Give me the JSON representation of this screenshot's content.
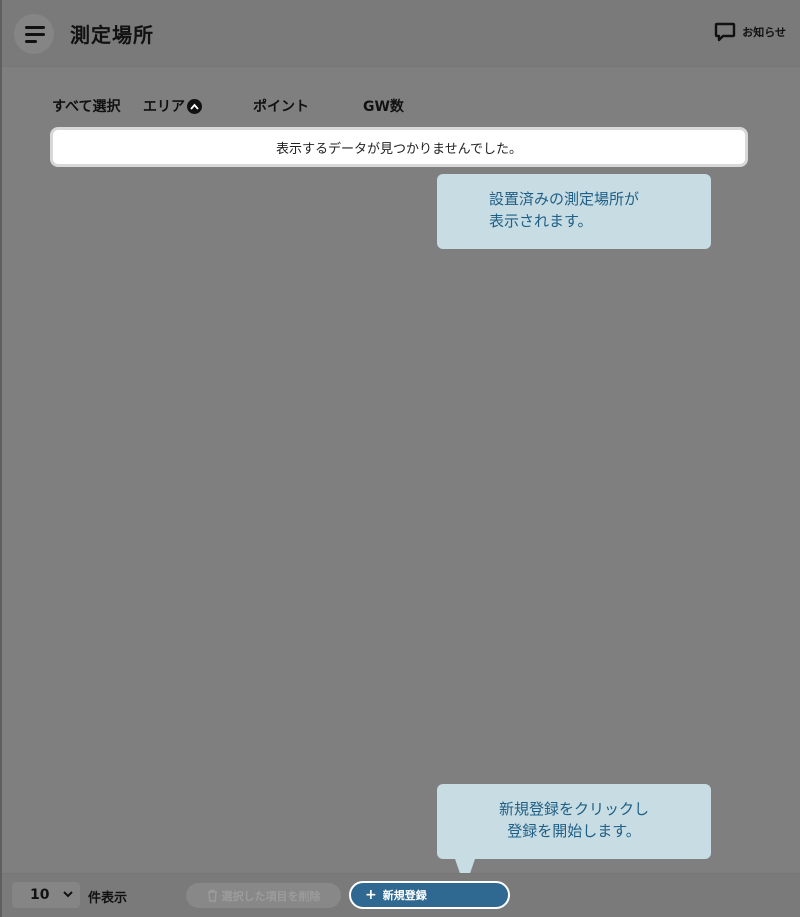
{
  "header": {
    "title": "測定場所",
    "notice_label": "お知らせ"
  },
  "table": {
    "columns": [
      {
        "label": "すべて選択"
      },
      {
        "label": "エリア"
      },
      {
        "label": "ポイント"
      },
      {
        "label": "GW数"
      }
    ],
    "empty_message": "表示するデータが見つかりませんでした。"
  },
  "tooltips": {
    "list_hint_line1": "設置済みの測定場所が",
    "list_hint_line2": "表示されます。",
    "new_hint_line1": "新規登録をクリックし",
    "new_hint_line2": "登録を開始します。"
  },
  "footer": {
    "page_size_value": "10",
    "page_size_label": "件表示",
    "delete_label": "選択した項目を削除",
    "new_label": "新規登録"
  },
  "colors": {
    "accent": "#2f6891",
    "tooltip_bg": "#c7dce3",
    "tooltip_text": "#1f5f86",
    "overlay": "#7f7f7f"
  }
}
